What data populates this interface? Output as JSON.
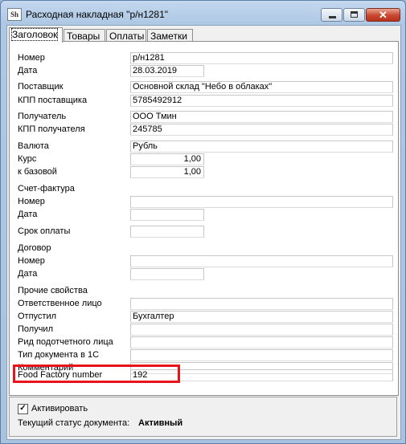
{
  "window": {
    "title": "Расходная накладная \"р/н1281\"",
    "icon_text": "Sh",
    "close_glyph": "✕"
  },
  "tabs": [
    {
      "label": "Заголовок",
      "active": true
    },
    {
      "label": "Товары",
      "active": false
    },
    {
      "label": "Оплаты",
      "active": false
    },
    {
      "label": "Заметки",
      "active": false
    }
  ],
  "fields": {
    "number": {
      "label": "Номер",
      "value": "р/н1281"
    },
    "date": {
      "label": "Дата",
      "value": "28.03.2019"
    },
    "supplier": {
      "label": "Поставщик",
      "value": "Основной склад \"Небо в облаках\""
    },
    "supplier_kpp": {
      "label": "КПП поставщика",
      "value": "5785492912"
    },
    "recipient": {
      "label": "Получатель",
      "value": "ООО Тмин"
    },
    "recipient_kpp": {
      "label": "КПП получателя",
      "value": "245785"
    },
    "currency": {
      "label": "Валюта",
      "value": "Рубль"
    },
    "rate": {
      "label": "Курс",
      "value": "1,00"
    },
    "base_ratio": {
      "label": "к базовой",
      "value": "1,00"
    },
    "invoice_header": "Счет-фактура",
    "invoice_number": {
      "label": "Номер",
      "value": ""
    },
    "invoice_date": {
      "label": "Дата",
      "value": ""
    },
    "payment_due": {
      "label": "Срок оплаты",
      "value": ""
    },
    "contract_header": "Договор",
    "contract_number": {
      "label": "Номер",
      "value": ""
    },
    "contract_date": {
      "label": "Дата",
      "value": ""
    },
    "other_header": "Прочие свойства",
    "responsible": {
      "label": "Ответственное лицо",
      "value": ""
    },
    "released_by": {
      "label": "Отпустил",
      "value": "Бухгалтер"
    },
    "received_by": {
      "label": "Получил",
      "value": ""
    },
    "accountable_kind": {
      "label": "Рид подотчетного лица",
      "value": ""
    },
    "doc_type_1c": {
      "label": "Тип документа в 1С",
      "value": ""
    },
    "comment": {
      "label": "Комментарий",
      "value": ""
    },
    "food_factory": {
      "label": "Food Factory number",
      "value": "192"
    }
  },
  "footer": {
    "activate_label": "Активировать",
    "activate_checked": true,
    "check_glyph": "✓",
    "status_label": "Текущий статус документа:",
    "status_value": "Активный"
  },
  "colors": {
    "highlight": "#e8141c",
    "close_button": "#c8472f"
  }
}
